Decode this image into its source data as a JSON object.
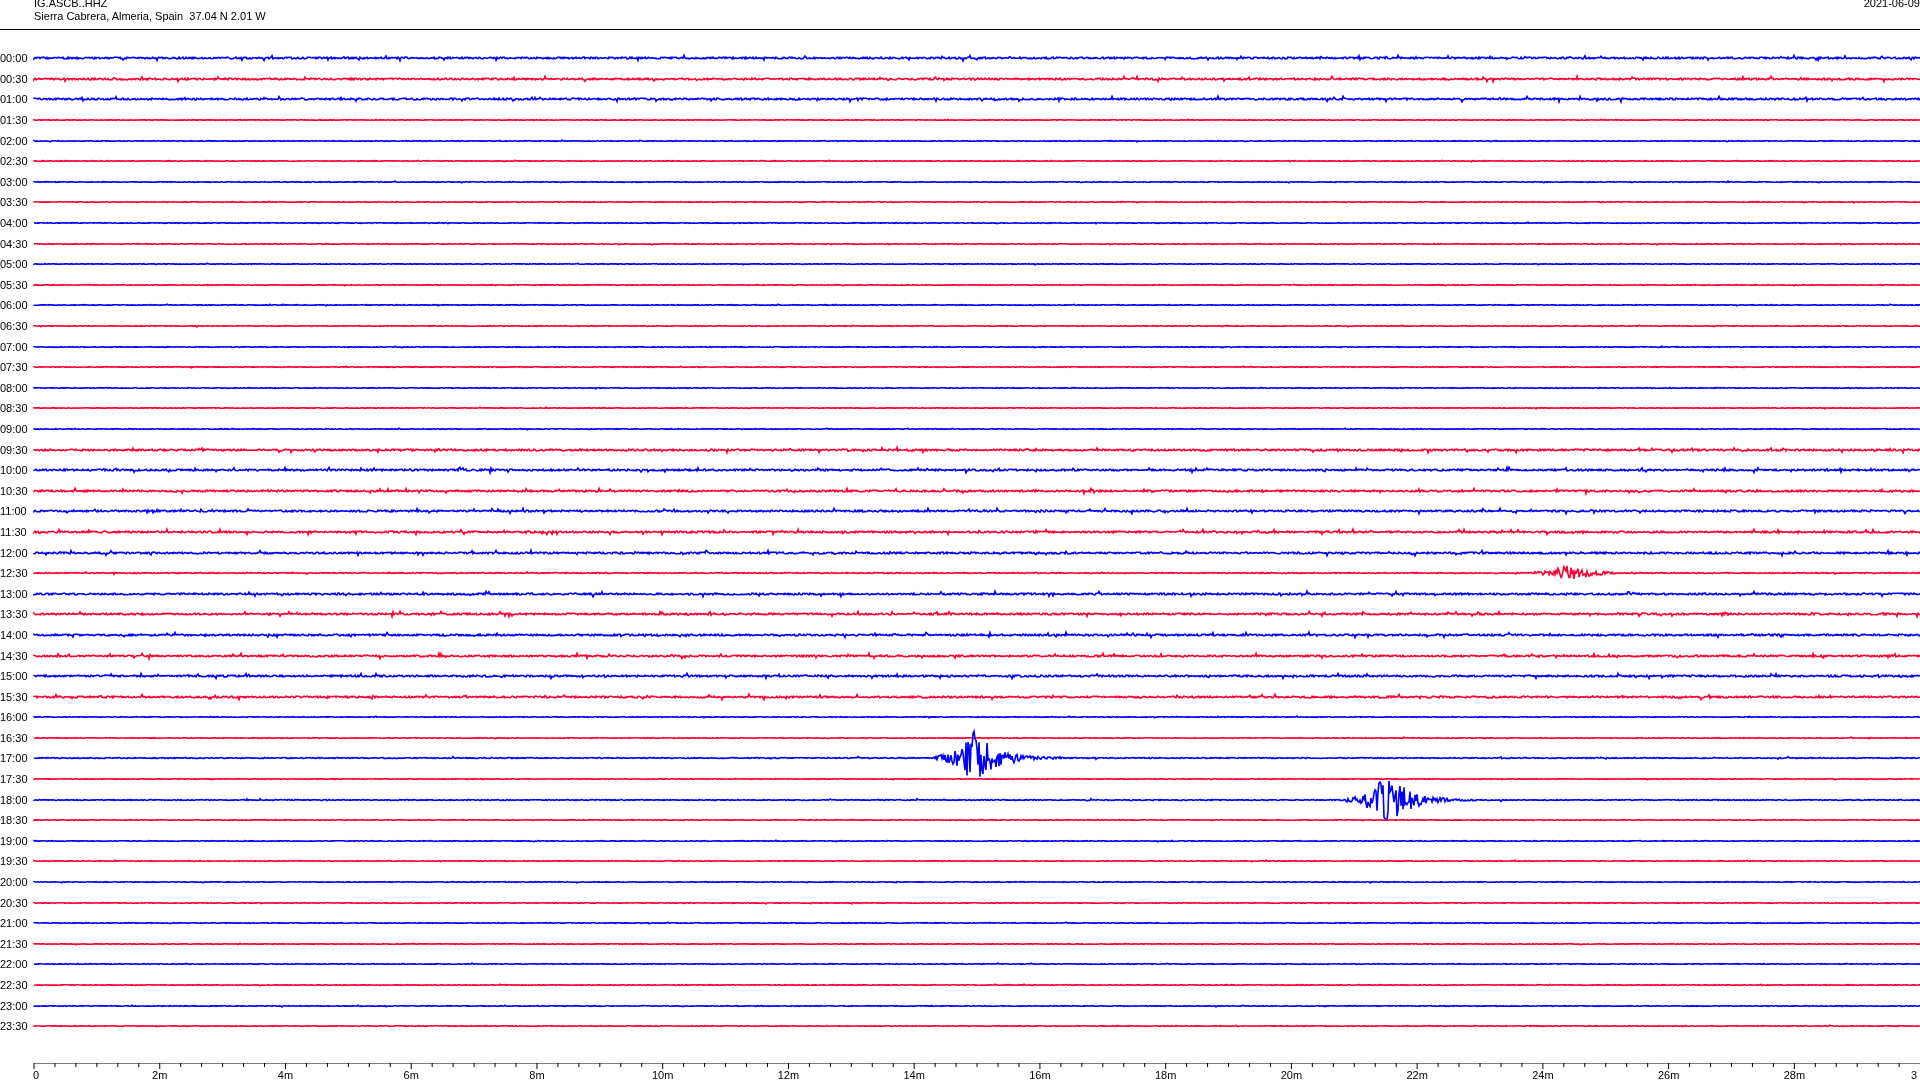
{
  "header": {
    "station": "IG.ASCB..HHZ",
    "location": "Sierra Cabrera, Almeria, Spain  37.04 N 2.01 W",
    "date": "2021-06-09"
  },
  "traces": [
    {
      "time": "00:00",
      "color": "#0000ff",
      "kind": "noisy"
    },
    {
      "time": "00:30",
      "color": "#ff0033",
      "kind": "noisy"
    },
    {
      "time": "01:00",
      "color": "#0000ff",
      "kind": "noisy"
    },
    {
      "time": "01:30",
      "color": "#ff0033",
      "kind": "quiet"
    },
    {
      "time": "02:00",
      "color": "#0000ff",
      "kind": "quiet"
    },
    {
      "time": "02:30",
      "color": "#ff0033",
      "kind": "quiet"
    },
    {
      "time": "03:00",
      "color": "#0000ff",
      "kind": "quiet"
    },
    {
      "time": "03:30",
      "color": "#ff0033",
      "kind": "quiet"
    },
    {
      "time": "04:00",
      "color": "#0000ff",
      "kind": "quiet"
    },
    {
      "time": "04:30",
      "color": "#ff0033",
      "kind": "quiet"
    },
    {
      "time": "05:00",
      "color": "#0000ff",
      "kind": "quiet"
    },
    {
      "time": "05:30",
      "color": "#ff0033",
      "kind": "quiet"
    },
    {
      "time": "06:00",
      "color": "#0000ff",
      "kind": "quiet"
    },
    {
      "time": "06:30",
      "color": "#ff0033",
      "kind": "quiet"
    },
    {
      "time": "07:00",
      "color": "#0000ff",
      "kind": "quiet"
    },
    {
      "time": "07:30",
      "color": "#ff0033",
      "kind": "quiet"
    },
    {
      "time": "08:00",
      "color": "#0000ff",
      "kind": "quiet"
    },
    {
      "time": "08:30",
      "color": "#ff0033",
      "kind": "quiet"
    },
    {
      "time": "09:00",
      "color": "#0000ff",
      "kind": "quiet"
    },
    {
      "time": "09:30",
      "color": "#ff0033",
      "kind": "noisy"
    },
    {
      "time": "10:00",
      "color": "#0000ff",
      "kind": "noisy"
    },
    {
      "time": "10:30",
      "color": "#ff0033",
      "kind": "noisy"
    },
    {
      "time": "11:00",
      "color": "#0000ff",
      "kind": "noisy"
    },
    {
      "time": "11:30",
      "color": "#ff0033",
      "kind": "noisy"
    },
    {
      "time": "12:00",
      "color": "#0000ff",
      "kind": "noisy"
    },
    {
      "time": "12:30",
      "color": "#ff0033",
      "kind": "event"
    },
    {
      "time": "13:00",
      "color": "#0000ff",
      "kind": "noisy"
    },
    {
      "time": "13:30",
      "color": "#ff0033",
      "kind": "noisy"
    },
    {
      "time": "14:00",
      "color": "#0000ff",
      "kind": "noisy"
    },
    {
      "time": "14:30",
      "color": "#ff0033",
      "kind": "noisy"
    },
    {
      "time": "15:00",
      "color": "#0000ff",
      "kind": "noisy"
    },
    {
      "time": "15:30",
      "color": "#ff0033",
      "kind": "noisy"
    },
    {
      "time": "16:00",
      "color": "#0000ff",
      "kind": "quiet"
    },
    {
      "time": "16:30",
      "color": "#ff0033",
      "kind": "quiet"
    },
    {
      "time": "17:00",
      "color": "#0000ff",
      "kind": "event"
    },
    {
      "time": "17:30",
      "color": "#ff0033",
      "kind": "quiet"
    },
    {
      "time": "18:00",
      "color": "#0000ff",
      "kind": "event"
    },
    {
      "time": "18:30",
      "color": "#ff0033",
      "kind": "quiet"
    },
    {
      "time": "19:00",
      "color": "#0000ff",
      "kind": "quiet"
    },
    {
      "time": "19:30",
      "color": "#ff0033",
      "kind": "quiet"
    },
    {
      "time": "20:00",
      "color": "#0000ff",
      "kind": "quiet"
    },
    {
      "time": "20:30",
      "color": "#ff0033",
      "kind": "quiet"
    },
    {
      "time": "21:00",
      "color": "#0000ff",
      "kind": "quiet"
    },
    {
      "time": "21:30",
      "color": "#ff0033",
      "kind": "quiet"
    },
    {
      "time": "22:00",
      "color": "#0000ff",
      "kind": "quiet"
    },
    {
      "time": "22:30",
      "color": "#ff0033",
      "kind": "quiet"
    },
    {
      "time": "23:00",
      "color": "#0000ff",
      "kind": "quiet"
    },
    {
      "time": "23:30",
      "color": "#ff0033",
      "kind": "quiet"
    }
  ],
  "time_axis": {
    "ticks": [
      "0",
      "2m",
      "4m",
      "6m",
      "8m",
      "10m",
      "12m",
      "14m",
      "16m",
      "18m",
      "20m",
      "22m",
      "24m",
      "26m",
      "28m",
      "3"
    ]
  }
}
